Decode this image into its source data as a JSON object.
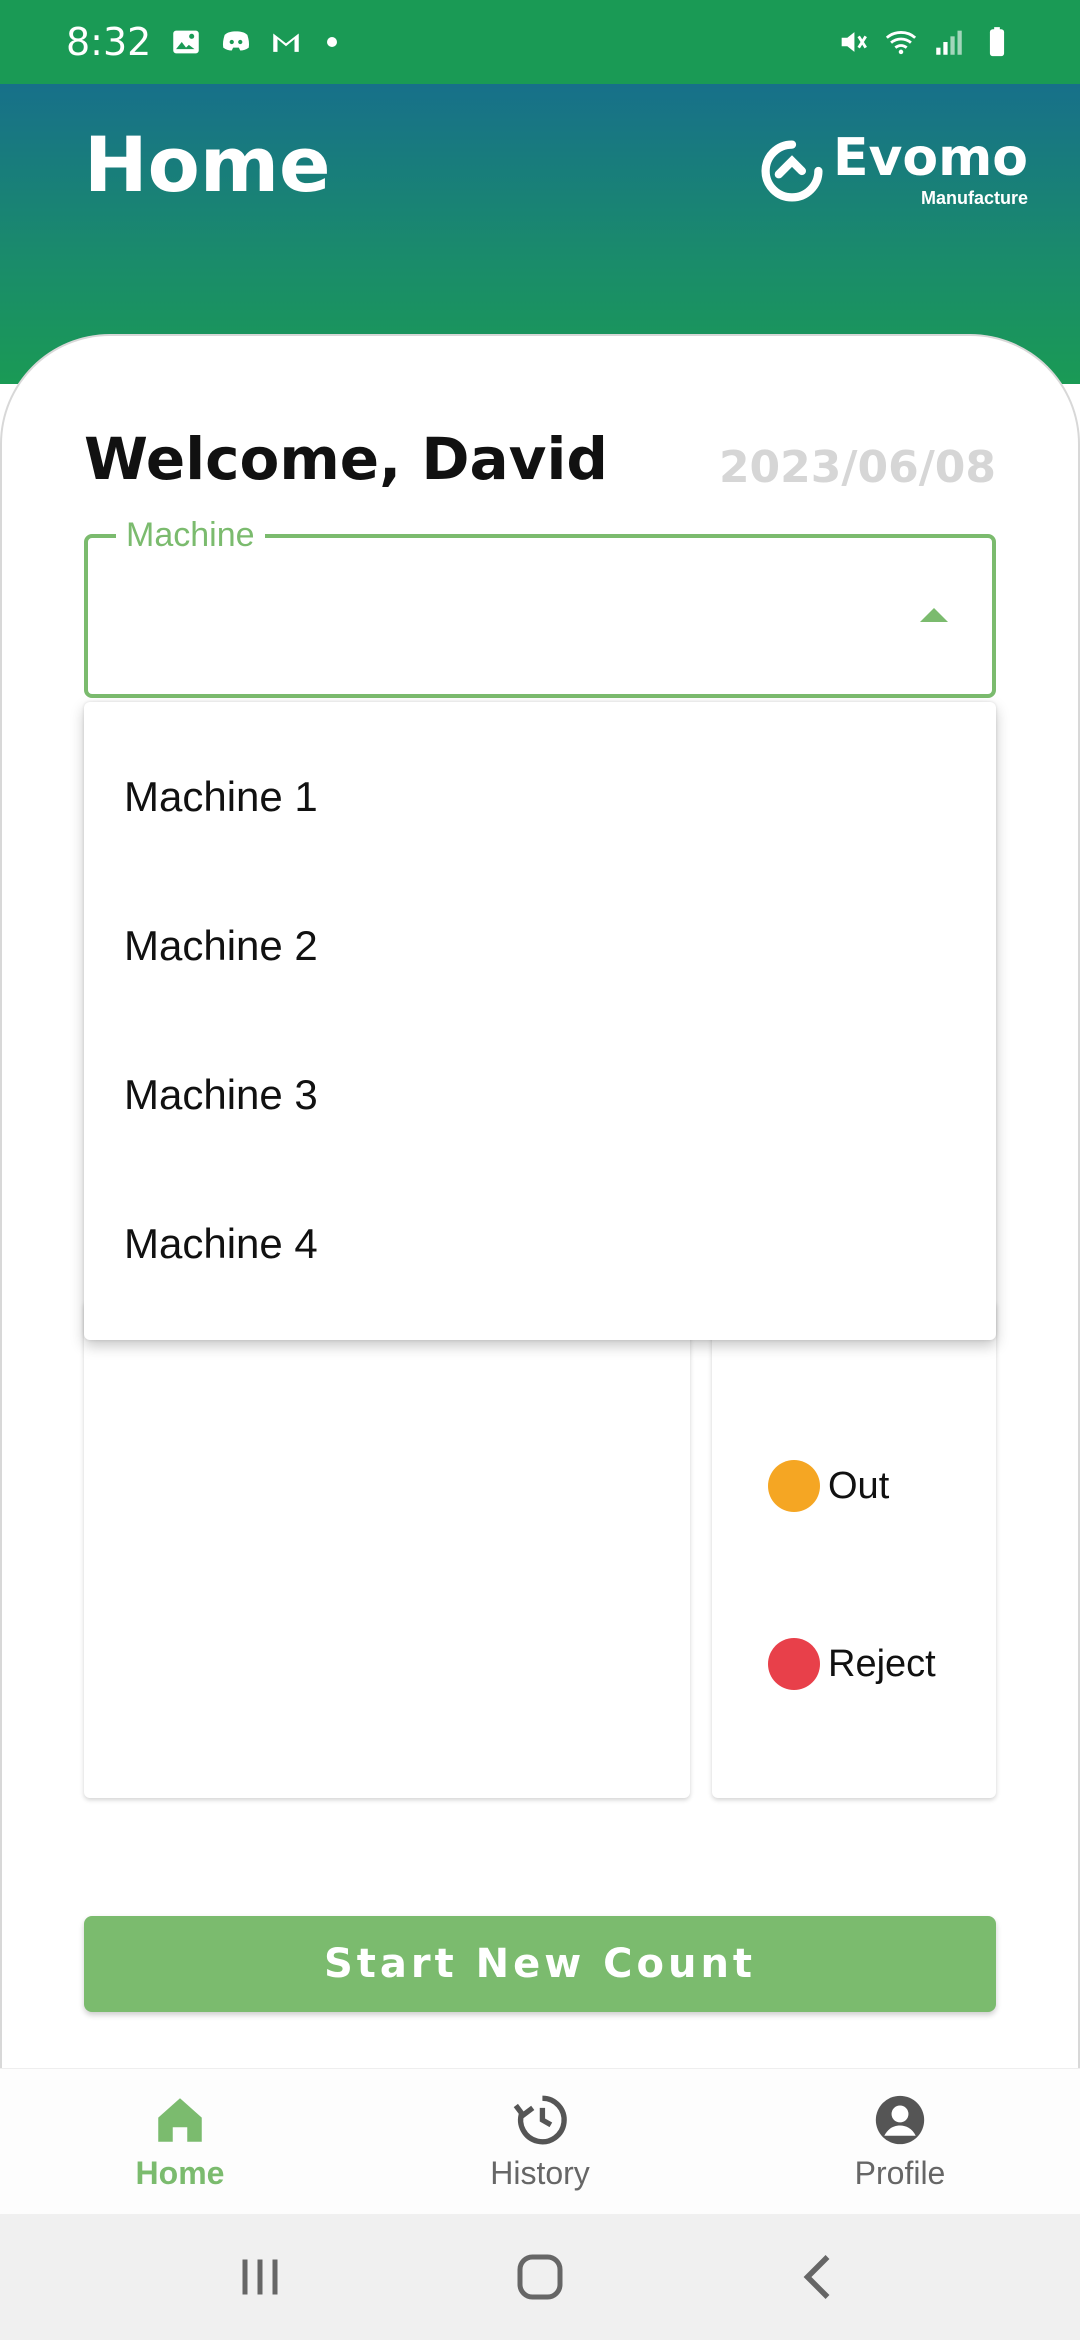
{
  "status_bar": {
    "time": "8:32",
    "left_icons": [
      "image-icon",
      "discord-icon",
      "gmail-icon",
      "dot-icon"
    ],
    "right_icons": [
      "mute-icon",
      "wifi-icon",
      "signal-icon",
      "battery-icon"
    ]
  },
  "header": {
    "title": "Home",
    "logo_text": "Evomo",
    "logo_subtext": "Manufacture"
  },
  "main": {
    "welcome": "Welcome, David",
    "date": "2023/06/08",
    "machine_select": {
      "label": "Machine",
      "value": "",
      "options": [
        "Machine 1",
        "Machine 2",
        "Machine 3",
        "Machine 4"
      ]
    },
    "legend": {
      "out": "Out",
      "reject": "Reject"
    },
    "start_button": "Start New Count"
  },
  "bottom_nav": {
    "items": [
      {
        "label": "Home",
        "icon": "home-icon",
        "active": true
      },
      {
        "label": "History",
        "icon": "history-icon",
        "active": false
      },
      {
        "label": "Profile",
        "icon": "profile-icon",
        "active": false
      }
    ]
  },
  "colors": {
    "status_bar": "#1a9a55",
    "accent_green": "#7bbb6e",
    "out_orange": "#f5a623",
    "reject_red": "#e8404a"
  }
}
